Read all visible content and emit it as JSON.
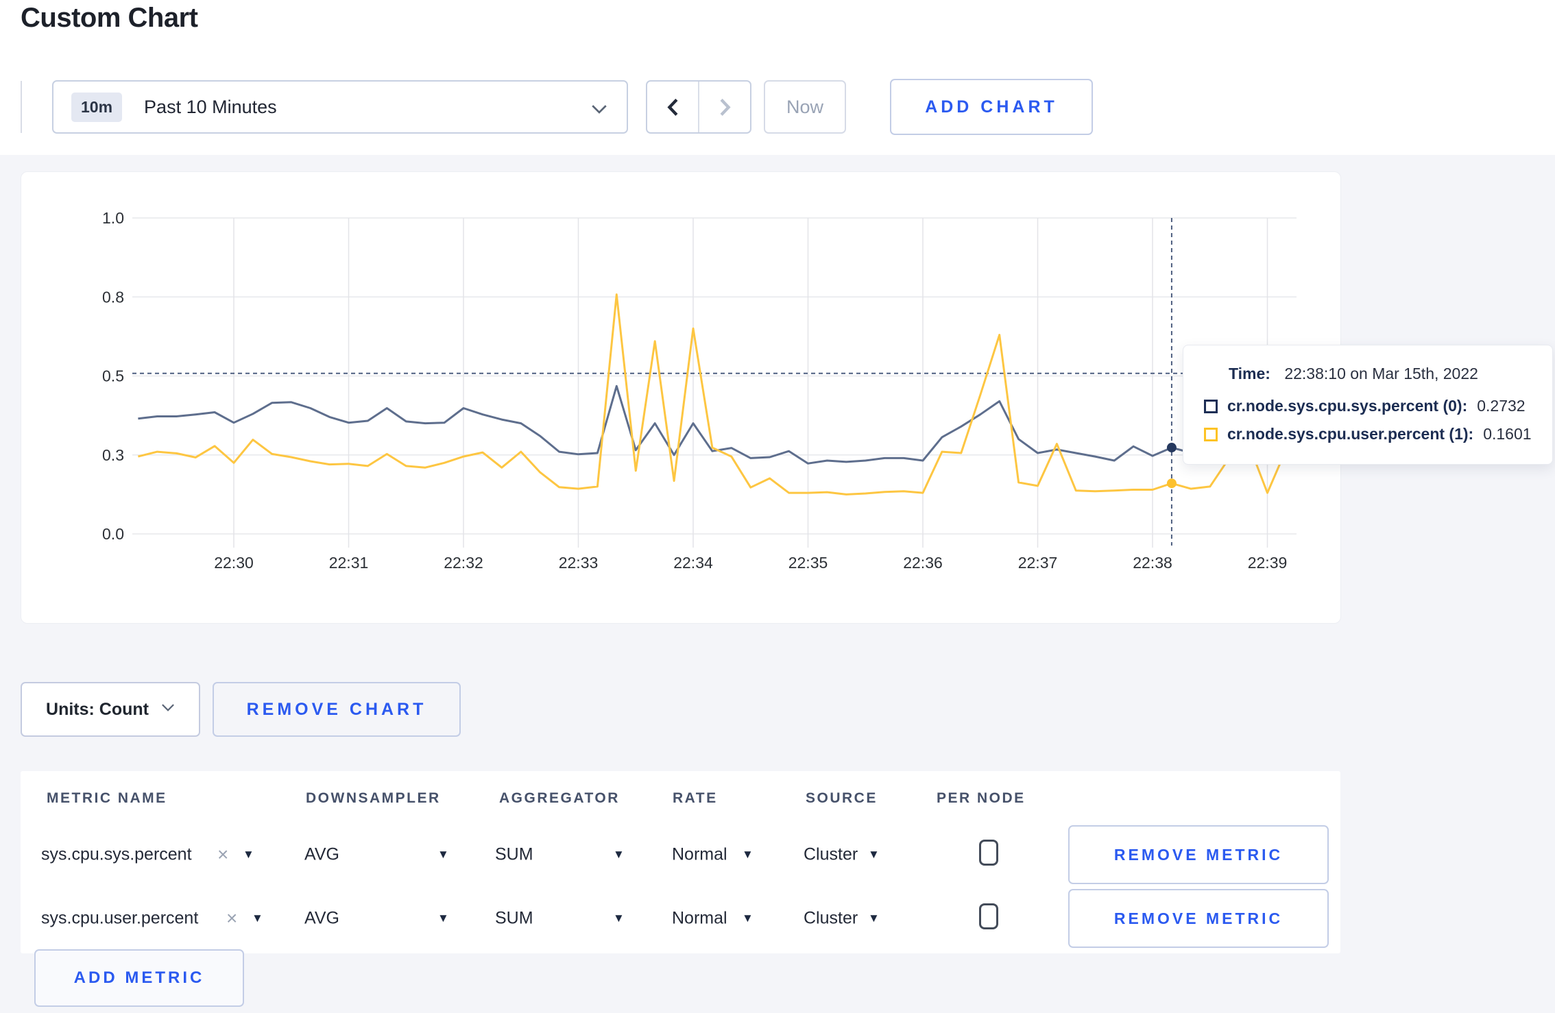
{
  "page": {
    "title": "Custom Chart"
  },
  "toolbar": {
    "time_window_badge": "10m",
    "time_window_label": "Past 10 Minutes",
    "prev_icon": "chevron-left",
    "next_icon": "chevron-right",
    "now_label": "Now",
    "add_chart_label": "ADD CHART"
  },
  "controls": {
    "units_label": "Units: Count",
    "remove_chart_label": "REMOVE CHART",
    "add_metric_label": "ADD METRIC"
  },
  "tooltip": {
    "time_label": "Time:",
    "time_value": "22:38:10 on Mar 15th, 2022",
    "series": [
      {
        "label": "cr.node.sys.cpu.sys.percent (0):",
        "value": "0.2732",
        "color": "#1d2e55"
      },
      {
        "label": "cr.node.sys.cpu.user.percent (1):",
        "value": "0.1601",
        "color": "#fdc325"
      }
    ]
  },
  "colors": {
    "accent_blue": "#2b5af0",
    "series_sys": "#5e6e8d",
    "series_user": "#fdc642",
    "crosshair": "#4d5e80",
    "gridline": "#e6e7eb",
    "page_bg": "#f4f5f9"
  },
  "chart_data": {
    "type": "line",
    "title": "",
    "xlabel": "",
    "ylabel": "",
    "ylim": [
      0,
      1.0
    ],
    "grid": true,
    "legend_position": "tooltip",
    "x_start": "22:29:10",
    "x_step_seconds": 10,
    "x_ticks": [
      "22:30",
      "22:31",
      "22:32",
      "22:33",
      "22:34",
      "22:35",
      "22:36",
      "22:37",
      "22:38",
      "22:39"
    ],
    "y_ticks": [
      {
        "value": 0,
        "label": "0.0"
      },
      {
        "value": 0.25,
        "label": "0.3"
      },
      {
        "value": 0.5,
        "label": "0.5"
      },
      {
        "value": 0.75,
        "label": "0.8"
      },
      {
        "value": 1.0,
        "label": "1.0"
      }
    ],
    "series": [
      {
        "name": "cr.node.sys.cpu.sys.percent",
        "color": "#5e6e8d",
        "dot_color": "#26395f",
        "values": [
          0.365,
          0.372,
          0.372,
          0.378,
          0.385,
          0.352,
          0.38,
          0.415,
          0.417,
          0.398,
          0.37,
          0.352,
          0.358,
          0.398,
          0.356,
          0.35,
          0.352,
          0.398,
          0.378,
          0.362,
          0.35,
          0.31,
          0.26,
          0.252,
          0.256,
          0.468,
          0.265,
          0.35,
          0.25,
          0.35,
          0.262,
          0.272,
          0.24,
          0.243,
          0.262,
          0.223,
          0.232,
          0.228,
          0.232,
          0.24,
          0.24,
          0.232,
          0.306,
          0.34,
          0.378,
          0.42,
          0.3,
          0.256,
          0.267,
          0.256,
          0.245,
          0.232,
          0.277,
          0.247,
          0.2732,
          0.257,
          0.262,
          0.27,
          0.268,
          0.272,
          0.27
        ]
      },
      {
        "name": "cr.node.sys.cpu.user.percent",
        "color": "#fdc642",
        "dot_color": "#fcc12e",
        "values": [
          0.245,
          0.26,
          0.255,
          0.242,
          0.278,
          0.225,
          0.298,
          0.253,
          0.243,
          0.23,
          0.22,
          0.222,
          0.215,
          0.253,
          0.215,
          0.21,
          0.225,
          0.245,
          0.258,
          0.21,
          0.26,
          0.195,
          0.148,
          0.143,
          0.15,
          0.758,
          0.2,
          0.61,
          0.168,
          0.65,
          0.273,
          0.245,
          0.147,
          0.176,
          0.13,
          0.13,
          0.132,
          0.125,
          0.128,
          0.133,
          0.135,
          0.13,
          0.26,
          0.256,
          0.44,
          0.63,
          0.163,
          0.152,
          0.285,
          0.137,
          0.135,
          0.137,
          0.14,
          0.14,
          0.1601,
          0.143,
          0.15,
          0.24,
          0.288,
          0.13,
          0.27
        ]
      }
    ],
    "crosshair": {
      "time": "22:38:10",
      "hline_value": 0.508,
      "point_values": [
        0.2732,
        0.1601
      ]
    }
  },
  "metrics_table": {
    "headers": [
      "METRIC NAME",
      "DOWNSAMPLER",
      "AGGREGATOR",
      "RATE",
      "SOURCE",
      "PER NODE"
    ],
    "rows": [
      {
        "metric": "sys.cpu.sys.percent",
        "downsampler": "AVG",
        "aggregator": "SUM",
        "rate": "Normal",
        "source": "Cluster",
        "per_node_checked": false,
        "remove_label": "REMOVE METRIC"
      },
      {
        "metric": "sys.cpu.user.percent",
        "downsampler": "AVG",
        "aggregator": "SUM",
        "rate": "Normal",
        "source": "Cluster",
        "per_node_checked": false,
        "remove_label": "REMOVE METRIC"
      }
    ]
  }
}
